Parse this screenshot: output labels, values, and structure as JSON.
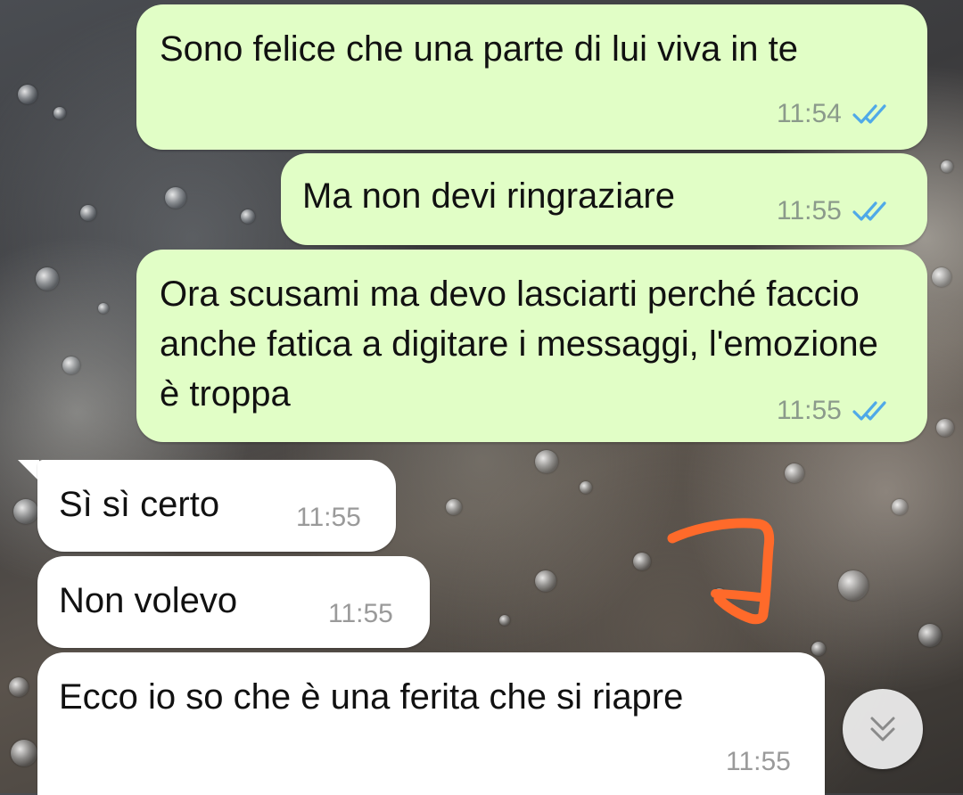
{
  "colors": {
    "outgoing_bubble": "#e1fec6",
    "incoming_bubble": "#ffffff",
    "read_ticks": "#4fa9e8",
    "annotation": "#ff6a2a"
  },
  "messages": [
    {
      "direction": "outgoing",
      "text": "Sono felice che una parte di lui viva in te",
      "time": "11:54",
      "status": "read-double-check-icon"
    },
    {
      "direction": "outgoing",
      "text": "Ma non devi ringraziare",
      "time": "11:55",
      "status": "read-double-check-icon"
    },
    {
      "direction": "outgoing",
      "text": "Ora scusami ma devo lasciarti perché faccio anche fatica a digitare i messaggi, l'emozione è troppa",
      "time": "11:55",
      "status": "read-double-check-icon"
    },
    {
      "direction": "incoming",
      "text": "Sì sì certo",
      "time": "11:55"
    },
    {
      "direction": "incoming",
      "text": "Non volevo",
      "time": "11:55"
    },
    {
      "direction": "incoming",
      "text": "Ecco io so che è una ferita che si riapre",
      "time": "11:55"
    }
  ],
  "controls": {
    "scroll_down_icon": "double-chevron-down-icon"
  },
  "annotation_icon": "orange-hand-drawn-mark"
}
